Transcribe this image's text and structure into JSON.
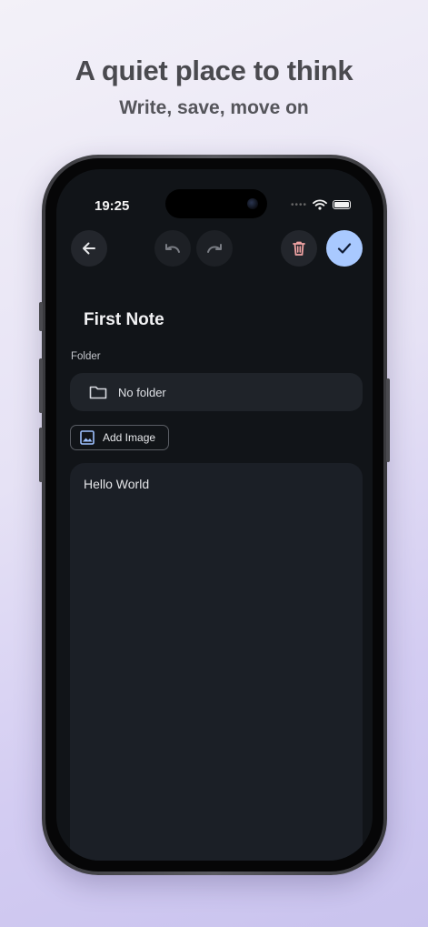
{
  "promo": {
    "headline": "A quiet place to think",
    "subline": "Write, save, move on"
  },
  "status_bar": {
    "time": "19:25",
    "icons": [
      "signal-dots-icon",
      "wifi-icon",
      "battery-icon"
    ]
  },
  "toolbar": {
    "back_icon": "arrow-left-icon",
    "undo_icon": "undo-icon",
    "redo_icon": "redo-icon",
    "delete_icon": "trash-icon",
    "save_icon": "checkmark-icon"
  },
  "note": {
    "title": "First Note",
    "folder_label": "Folder",
    "folder_value": "No folder",
    "add_image_label": "Add Image",
    "body": "Hello World"
  },
  "colors": {
    "screen_bg": "#111418",
    "save_accent": "#a9c9ff",
    "delete_icon": "#f0a3a3",
    "image_icon": "#9ec1ff"
  }
}
